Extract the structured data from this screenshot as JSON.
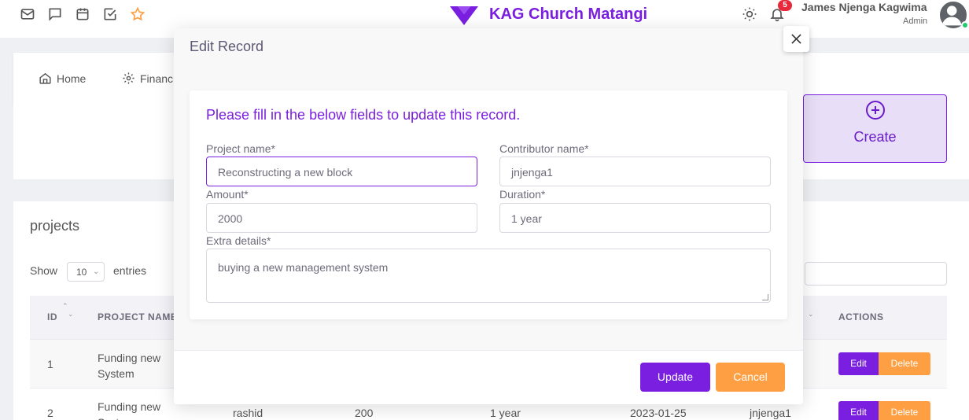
{
  "navbar": {
    "icons": [
      "mail-icon",
      "chat-icon",
      "calendar-icon",
      "check-square-icon",
      "star-icon",
      "sun-icon",
      "bell-icon"
    ],
    "brand_name": "KAG Church Matangi",
    "notification_count": "5",
    "user_name": "James Njenga Kagwima",
    "user_role": "Admin"
  },
  "menu": {
    "items": [
      {
        "label": "Home",
        "icon": "home-icon"
      },
      {
        "label": "Financ",
        "icon": "gear-icon"
      }
    ]
  },
  "create_card": {
    "label": "Create",
    "icon": "plus-circle-icon"
  },
  "projects": {
    "title": "projects",
    "show_label": "Show",
    "entries_value": "10",
    "entries_label": "entries",
    "columns": [
      "ID",
      "PROJECT NAME",
      "ACTIONS"
    ],
    "rows": [
      {
        "id": "1",
        "project": "Funding new System",
        "contributor": "",
        "amount": "",
        "duration": "",
        "date": "",
        "user": ""
      },
      {
        "id": "2",
        "project": "Funding new System",
        "contributor": "rashid",
        "amount": "200",
        "duration": "1 year",
        "date": "2023-01-25",
        "user": "jnjenga1"
      }
    ],
    "edit_label": "Edit",
    "delete_label": "Delete"
  },
  "modal": {
    "title": "Edit Record",
    "heading": "Please fill in the below fields to update this record.",
    "fields": {
      "project_name": {
        "label": "Project name*",
        "value": "Reconstructing a new block"
      },
      "contributor_name": {
        "label": "Contributor name*",
        "value": "jnjenga1"
      },
      "amount": {
        "label": "Amount*",
        "value": "2000"
      },
      "duration": {
        "label": "Duration*",
        "value": "1 year"
      },
      "extra_details": {
        "label": "Extra details*",
        "value": "buying a new management system"
      }
    },
    "update_label": "Update",
    "cancel_label": "Cancel"
  },
  "colors": {
    "primary": "#7a1fe0",
    "warning": "#ff9f43",
    "badge": "#e6293b",
    "online": "#28c76f"
  }
}
